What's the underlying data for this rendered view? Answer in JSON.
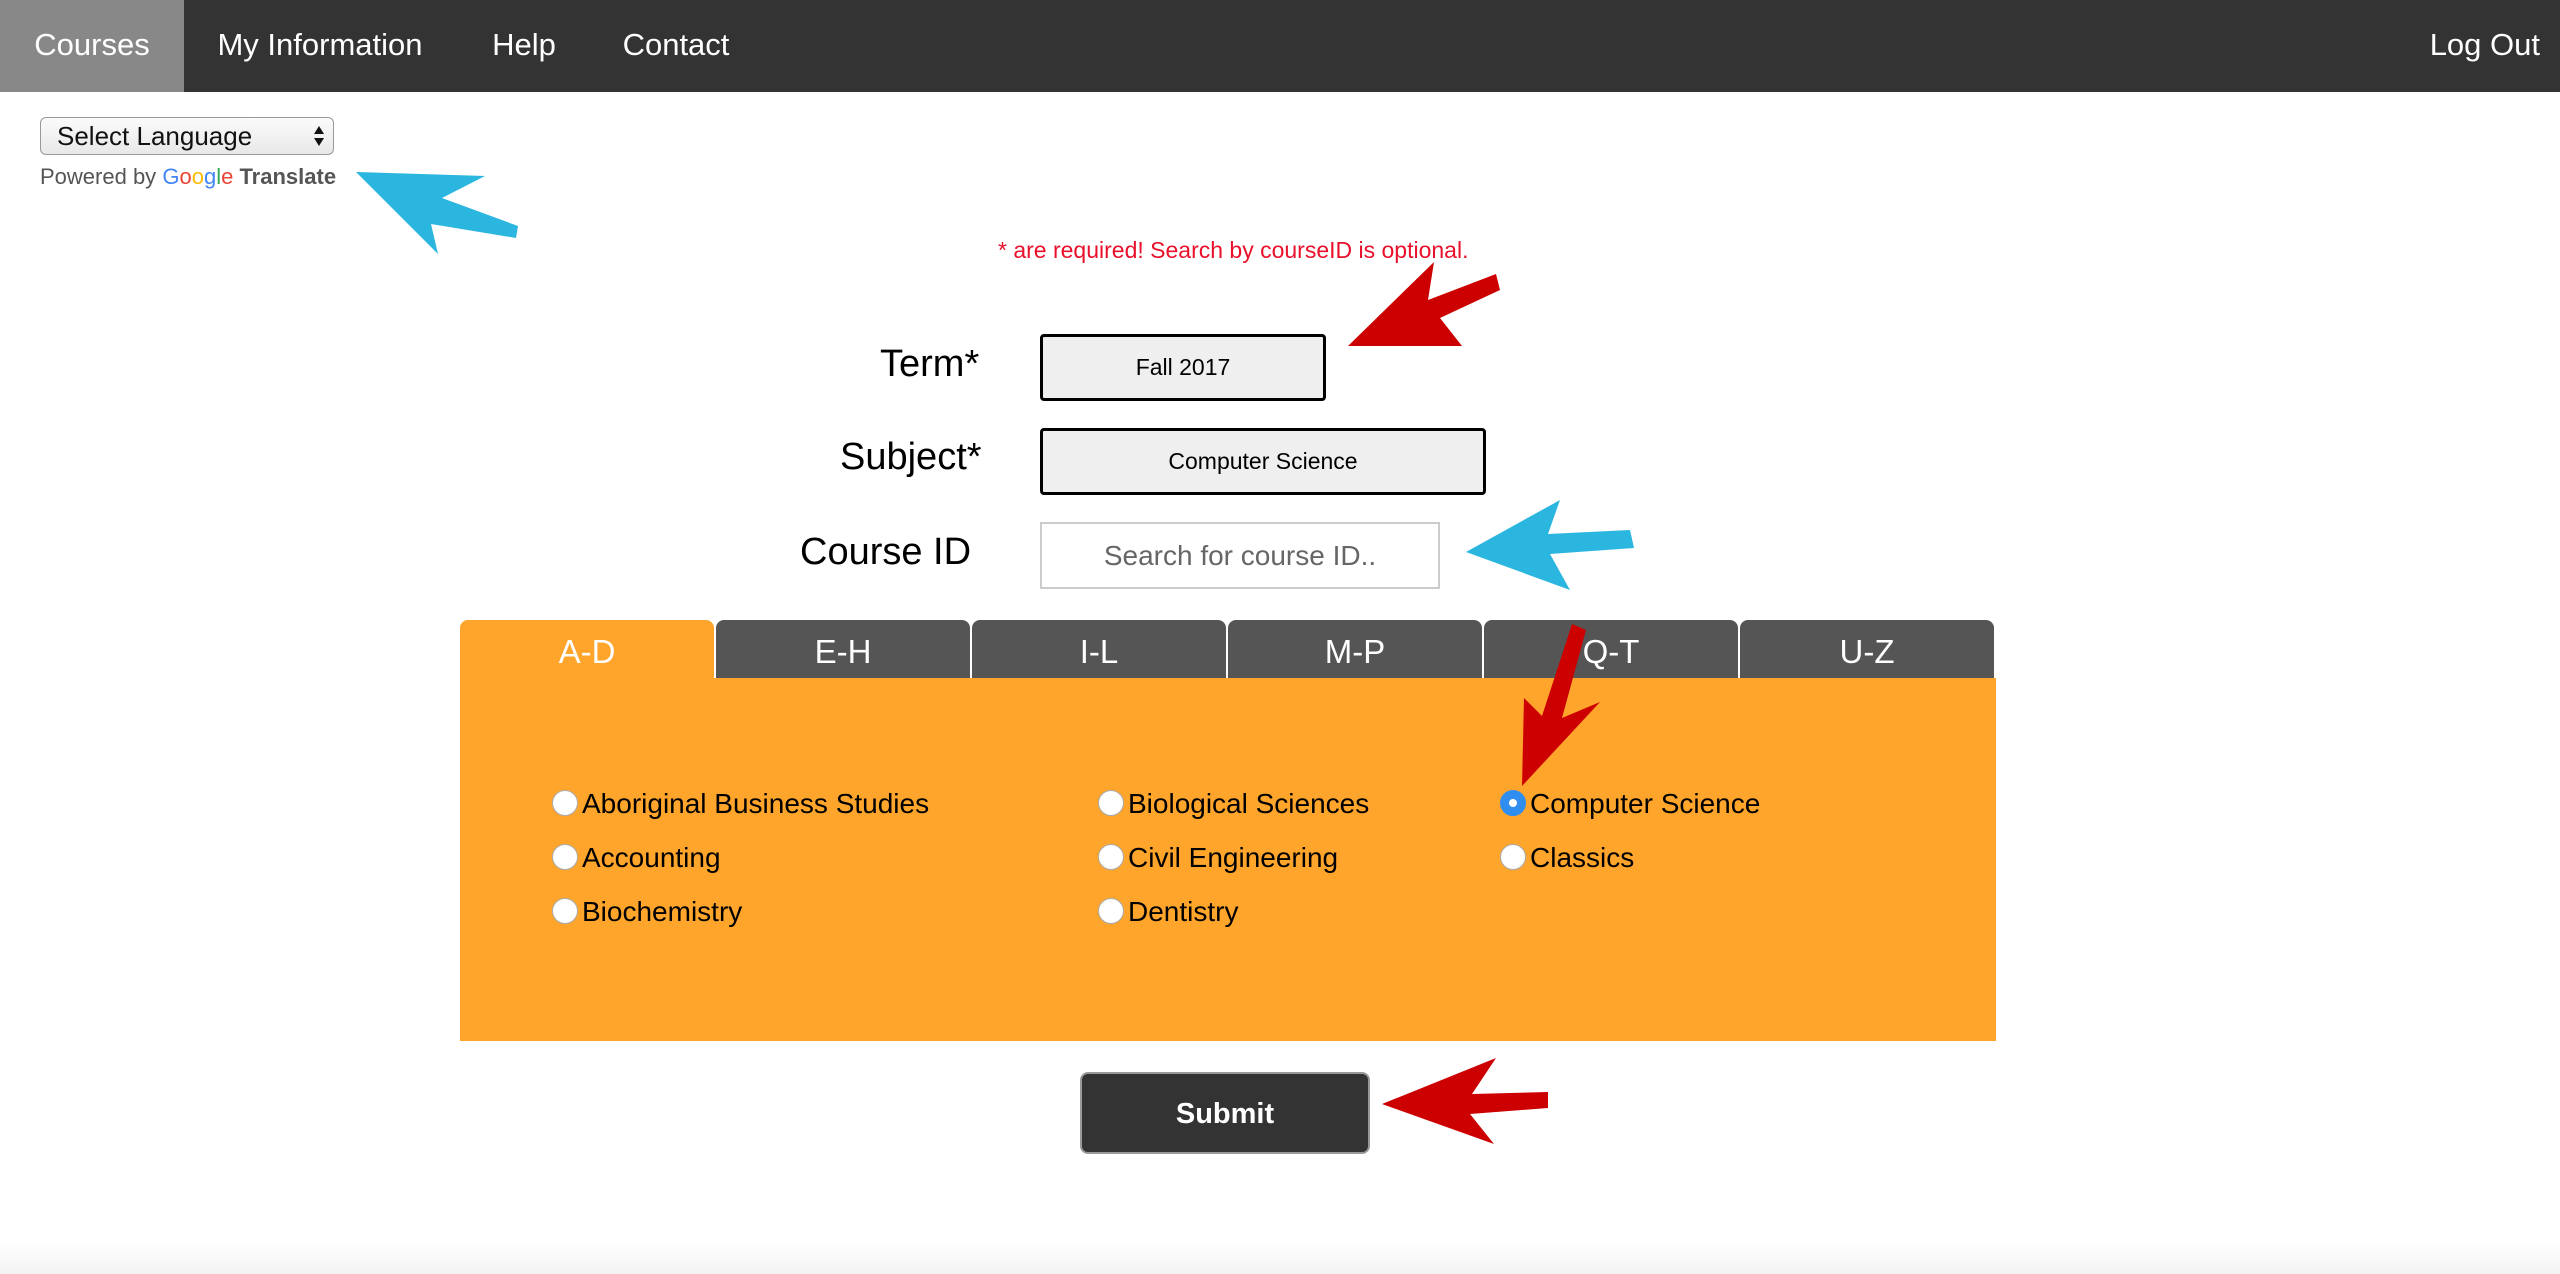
{
  "nav": {
    "items": [
      {
        "label": "Courses",
        "active": true
      },
      {
        "label": "My Information"
      },
      {
        "label": "Help"
      },
      {
        "label": "Contact"
      }
    ],
    "logout_label": "Log Out"
  },
  "translate": {
    "select_label": "Select Language",
    "powered_by": "Powered by",
    "google_letters": [
      "G",
      "o",
      "o",
      "g",
      "l",
      "e"
    ],
    "google_colors": [
      "#4285f4",
      "#ea4335",
      "#fbbc05",
      "#4285f4",
      "#34a853",
      "#ea4335"
    ],
    "translate_label": "Translate"
  },
  "form": {
    "required_note": "* are required! Search by courseID is optional.",
    "term_label": "Term*",
    "term_value": "Fall 2017",
    "subject_label": "Subject*",
    "subject_value": "Computer Science",
    "courseid_label": "Course ID",
    "courseid_placeholder": "Search for course ID.."
  },
  "tabs": {
    "labels": [
      "A-D",
      "E-H",
      "I-L",
      "M-P",
      "Q-T",
      "U-Z"
    ],
    "active": "A-D"
  },
  "subjects": [
    {
      "label": "Aboriginal Business Studies",
      "checked": false
    },
    {
      "label": "Accounting",
      "checked": false
    },
    {
      "label": "Biochemistry",
      "checked": false
    },
    {
      "label": "Biological Sciences",
      "checked": false
    },
    {
      "label": "Civil Engineering",
      "checked": false
    },
    {
      "label": "Dentistry",
      "checked": false
    },
    {
      "label": "Computer Science",
      "checked": true
    },
    {
      "label": "Classics",
      "checked": false
    }
  ],
  "submit_label": "Submit",
  "colors": {
    "navbar": "#333333",
    "nav_active": "#888888",
    "tab_active": "#ffa52c",
    "tab_inactive": "#555555",
    "required_text": "#e8102a",
    "radio_checked": "#2f8ef0",
    "annotation_blue": "#2bb6e0",
    "annotation_red": "#cc0000"
  }
}
